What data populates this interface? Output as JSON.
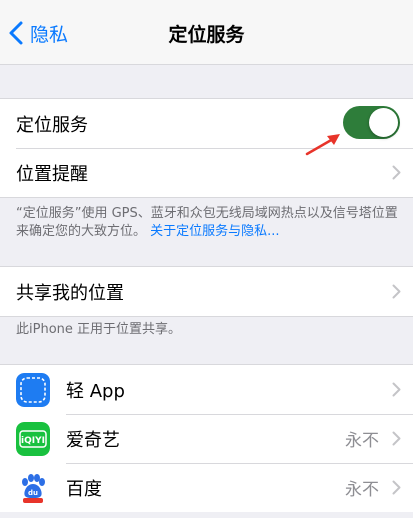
{
  "nav": {
    "back_label": "隐私",
    "title": "定位服务"
  },
  "location_group": {
    "location_services_label": "定位服务",
    "location_services_on": true,
    "toggle_color": "#2e7d3a",
    "location_alerts_label": "位置提醒"
  },
  "location_footer": {
    "text": "“定位服务”使用 GPS、蓝牙和众包无线局域网热点以及信号塔位置来确定您的大致方位。",
    "link": "关于定位服务与隐私..."
  },
  "share_group": {
    "share_location_label": "共享我的位置"
  },
  "share_footer": "此iPhone 正用于位置共享。",
  "apps": [
    {
      "name": "轻 App",
      "value": "",
      "icon": "light-app-icon"
    },
    {
      "name": "爱奇艺",
      "value": "永不",
      "icon": "iqiyi-icon",
      "icon_text": "iQIYI"
    },
    {
      "name": "百度",
      "value": "永不",
      "icon": "baidu-icon",
      "icon_text": "du"
    }
  ],
  "colors": {
    "accent": "#0a7aff",
    "annotation_arrow": "#e8342a",
    "iqiyi_green": "#19c13f",
    "baidu_blue": "#2d6fe6"
  }
}
